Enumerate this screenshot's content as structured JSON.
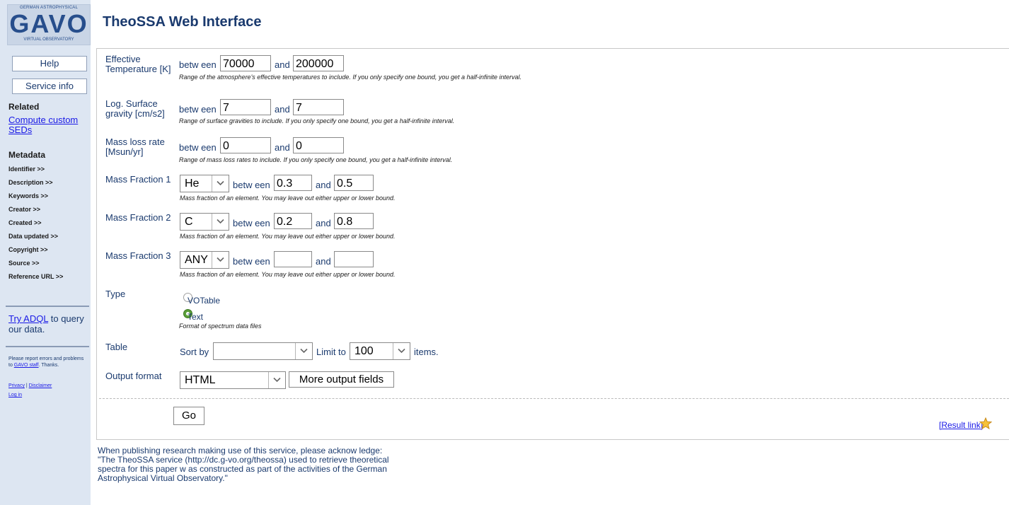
{
  "logo": {
    "top": "GERMAN ASTROPHYSICAL",
    "main": "GAVO",
    "bottom": "VIRTUAL OBSERVATORY"
  },
  "title": "TheoSSA Web Interface",
  "sidebar": {
    "help_label": "Help",
    "service_info_label": "Service info",
    "related_heading": "Related",
    "related_link": "Compute custom SEDs",
    "metadata_heading": "Metadata",
    "metadata_items": [
      "Identifier >>",
      "Description >>",
      "Keywords >>",
      "Creator >>",
      "Created >>",
      "Data updated >>",
      "Copyright >>",
      "Source >>",
      "Reference URL >>"
    ],
    "adql_link": "Try ADQL",
    "adql_rest": "to query our data.",
    "report_text": "Please report errors and problems to",
    "report_link": "GAVO staff",
    "report_end": ". Thanks.",
    "privacy": "Privacy",
    "separator": " | ",
    "disclaimer": "Disclaimer",
    "login": "Log in"
  },
  "form": {
    "between": "betw een",
    "and": "and",
    "teff": {
      "label": "Effective Temperature [K]",
      "low": "70000",
      "high": "200000",
      "hint": "Range of the atmosphere's effective temperatures to include. If you only specify one bound, you get a half-infinite interval."
    },
    "logg": {
      "label": "Log. Surface gravity [cm/s2]",
      "low": "7",
      "high": "7",
      "hint": "Range of surface gravities to include. If you only specify one bound, you get a half-infinite interval."
    },
    "mdot": {
      "label": "Mass loss rate [Msun/yr]",
      "low": "0",
      "high": "0",
      "hint": "Range of mass loss rates to include. If you only specify one bound, you get a half-infinite interval."
    },
    "mf1": {
      "label": "Mass Fraction 1",
      "element": "He",
      "low": "0.3",
      "high": "0.5",
      "hint": "Mass fraction of an element. You may leave out either upper or lower bound."
    },
    "mf2": {
      "label": "Mass Fraction 2",
      "element": "C",
      "low": "0.2",
      "high": "0.8",
      "hint": "Mass fraction of an element. You may leave out either upper or lower bound."
    },
    "mf3": {
      "label": "Mass Fraction 3",
      "element": "ANY",
      "low": "",
      "high": "",
      "hint": "Mass fraction of an element. You may leave out either upper or lower bound."
    },
    "type": {
      "label": "Type",
      "option1": "VOTable",
      "option2": "Text",
      "selected": "Text",
      "hint": "Format of spectrum data files"
    },
    "table": {
      "label": "Table",
      "sort_by": "Sort by",
      "sort_value": "",
      "limit_to": "Limit to",
      "limit_value": "100",
      "items": "items."
    },
    "output": {
      "label": "Output format",
      "format": "HTML",
      "more_fields": "More output fields"
    },
    "go": "Go",
    "result_link": "[Result link]"
  },
  "acknowledgement": "When publishing research making use of this service, please acknow ledge: \"The TheoSSA service (http://dc.g-vo.org/theossa) used to retrieve theoretical spectra for this paper w as constructed as part of the activities of the German Astrophysical Virtual Observatory.\""
}
